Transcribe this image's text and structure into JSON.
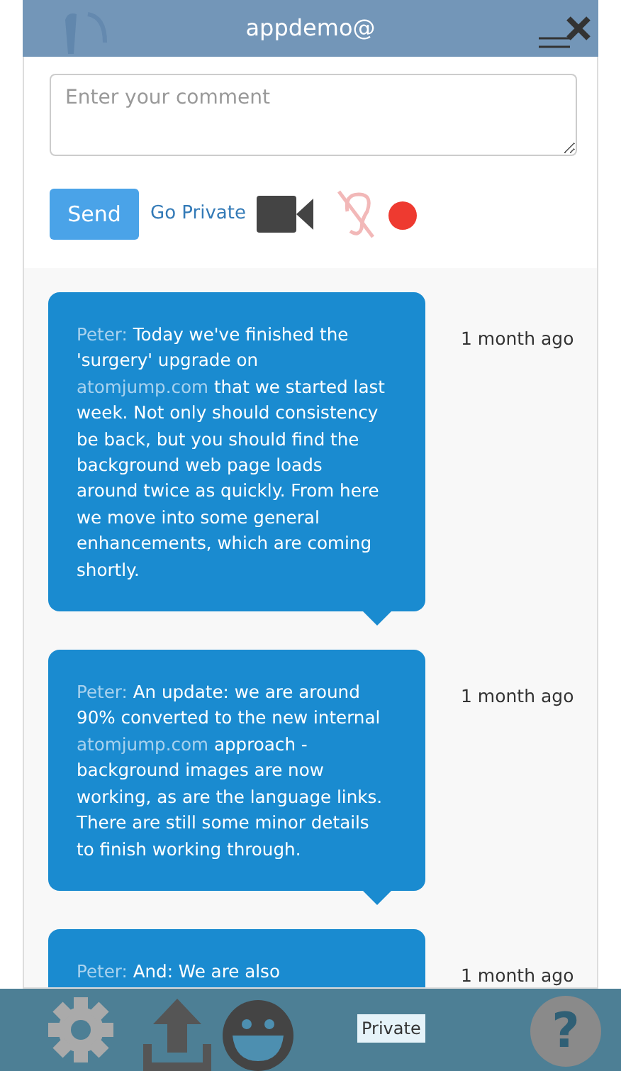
{
  "header": {
    "title": "appdemo@"
  },
  "compose": {
    "placeholder": "Enter your comment",
    "send_label": "Send",
    "private_link": "Go Private",
    "recording": true
  },
  "messages": [
    {
      "author": "Peter:",
      "segments": [
        {
          "kind": "text",
          "text": " Today we've finished the 'surgery' upgrade on "
        },
        {
          "kind": "link",
          "text": "atomjump.com"
        },
        {
          "kind": "text",
          "text": " that we started last week. Not only should consistency be back, but you should find the background web page loads around twice as quickly. From here we move into some general enhancements, which are coming shortly."
        }
      ],
      "time": "1 month ago",
      "pointer": true
    },
    {
      "author": "Peter:",
      "segments": [
        {
          "kind": "text",
          "text": " An update: we are around 90% converted to the new internal "
        },
        {
          "kind": "link",
          "text": "atomjump.com"
        },
        {
          "kind": "text",
          "text": " approach - background images are now working, as are the language links. There are still some minor details to finish working through."
        }
      ],
      "time": "1 month ago",
      "pointer": true
    },
    {
      "author": "Peter:",
      "segments": [
        {
          "kind": "text",
          "text": " And: We are also"
        }
      ],
      "time": "1 month ago",
      "pointer": false
    }
  ],
  "footer": {
    "tooltip": "Private",
    "help_label": "?"
  }
}
